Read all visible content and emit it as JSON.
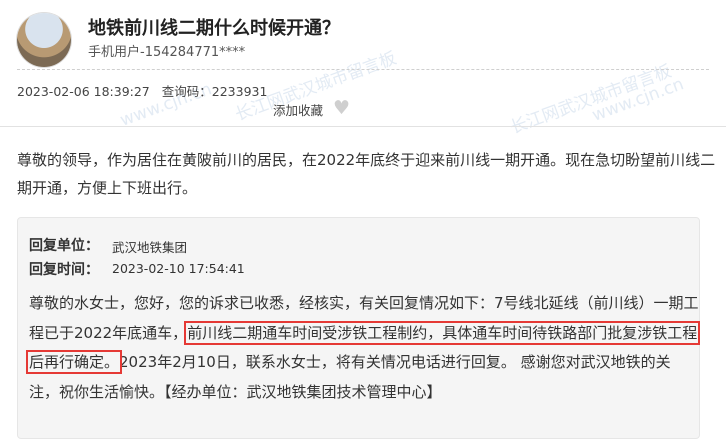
{
  "post": {
    "title": "地铁前川线二期什么时候开通？",
    "user": "手机用户-154284771****",
    "date": "2023-02-06 18:39:27",
    "query_label": "查询码：",
    "query_code": "2233931",
    "favorite_label": "添加收藏",
    "content": "尊敬的领导，作为居住在黄陂前川的居民，在2022年底终于迎来前川线一期开通。现在急切盼望前川线二期开通，方便上下班出行。"
  },
  "reply": {
    "unit_label": "回复单位：",
    "unit": "武汉地铁集团",
    "time_label": "回复时间：",
    "time": "2023-02-10 17:54:41",
    "text_part1": "尊敬的水女士，您好，您的诉求已收悉，经核实，有关回复情况如下：7号线北延线（前川线）一期工程已于2022年底通车，",
    "text_highlight": "前川线二期通车时间受涉铁工程制约，具体通车时间待铁路部门批复涉铁工程后再行确定。",
    "text_part2": "2023年2月10日，联系水女士，将有关情况电话进行回复。 感谢您对武汉地铁的关注，祝你生活愉快。【经办单位：武汉地铁集团技术管理中心】"
  },
  "watermark": {
    "text1": "长江网武汉城市留言板",
    "text2": "www.cjn.cn"
  },
  "colors": {
    "highlight_border": "#e53935",
    "reply_bg": "#f5f5f5"
  }
}
